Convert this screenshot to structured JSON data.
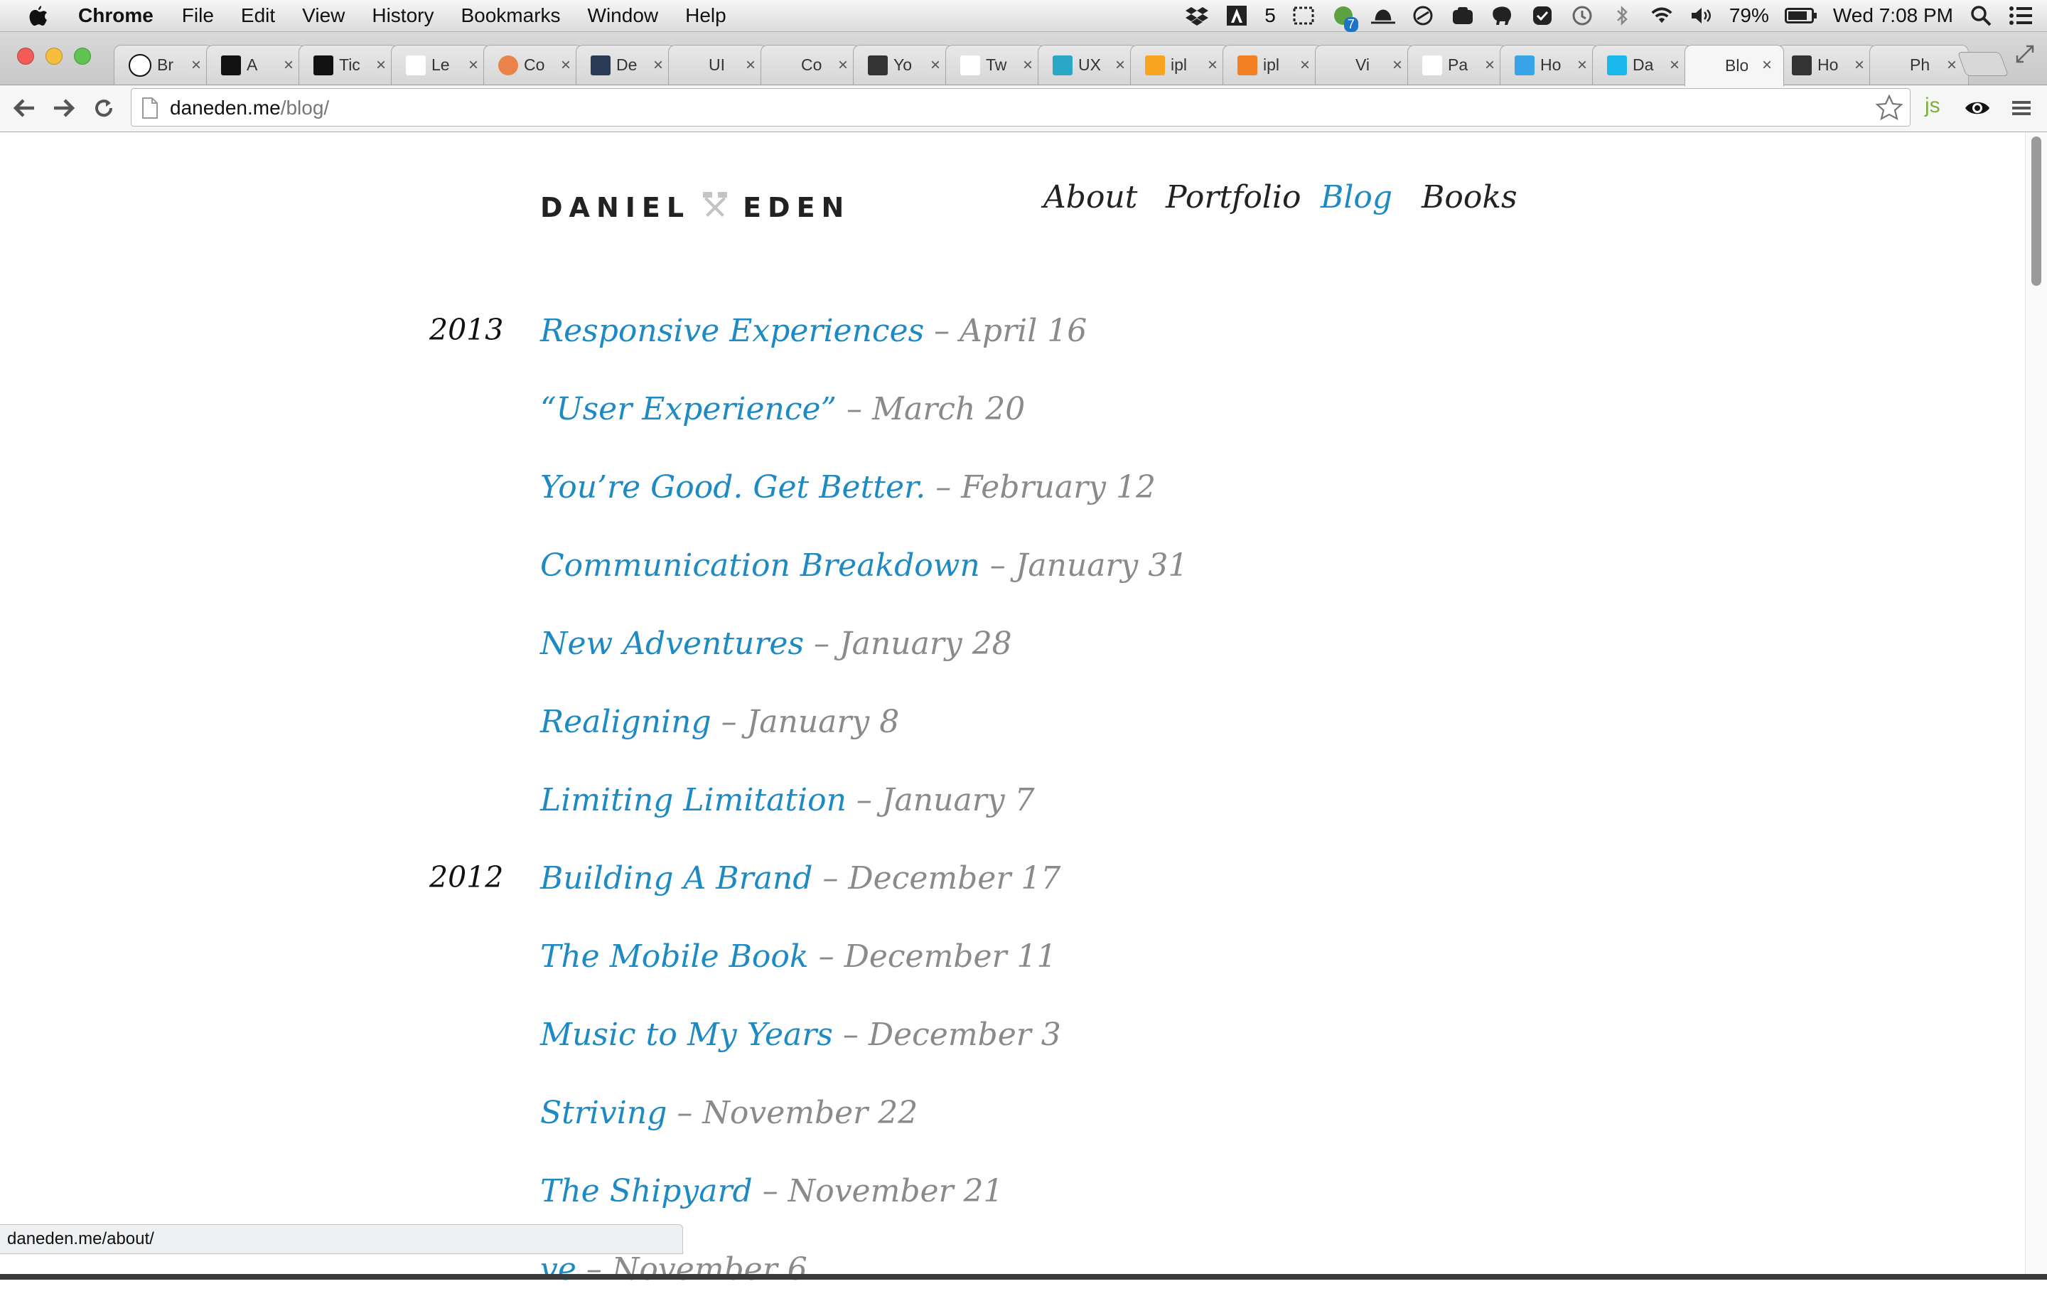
{
  "menubar": {
    "app_name": "Chrome",
    "items": [
      "File",
      "Edit",
      "View",
      "History",
      "Bookmarks",
      "Window",
      "Help"
    ],
    "adobe_count": "5",
    "evernote_badge": "7",
    "battery": "79%",
    "clock": "Wed 7:08 PM"
  },
  "tabs": [
    {
      "title": "Br",
      "favicon": "github-icon"
    },
    {
      "title": "A",
      "favicon": "medium-icon"
    },
    {
      "title": "Tic",
      "favicon": "tictail-icon"
    },
    {
      "title": "Le",
      "favicon": "lettering-icon"
    },
    {
      "title": "Co",
      "favicon": "codepen-icon"
    },
    {
      "title": "De",
      "favicon": "dribbble-icon"
    },
    {
      "title": "UI",
      "favicon": "apple-icon"
    },
    {
      "title": "Co",
      "favicon": "apple-icon"
    },
    {
      "title": "Yo",
      "favicon": "a-icon"
    },
    {
      "title": "Tw",
      "favicon": "typekit-icon"
    },
    {
      "title": "UX",
      "favicon": "ux-icon"
    },
    {
      "title": "ipl",
      "favicon": "iplayer-icon"
    },
    {
      "title": "ipl",
      "favicon": "stack-icon"
    },
    {
      "title": "Vi",
      "favicon": "apple-icon"
    },
    {
      "title": "Pa",
      "favicon": "dt-icon"
    },
    {
      "title": "Ho",
      "favicon": "quote-icon"
    },
    {
      "title": "Da",
      "favicon": "vimeo-icon"
    },
    {
      "title": "Blo",
      "favicon": "hammers-icon",
      "active": true
    },
    {
      "title": "Ho",
      "favicon": "bc-icon"
    },
    {
      "title": "Ph",
      "favicon": "ph-icon"
    }
  ],
  "toolbar": {
    "url_host": "daneden.me",
    "url_path": "/blog/",
    "extension_js": "js"
  },
  "site": {
    "logo_first": "DANIEL",
    "logo_last": "EDEN",
    "nav": {
      "about": "About",
      "portfolio": "Portfolio",
      "blog": "Blog",
      "books": "Books"
    }
  },
  "posts": [
    {
      "year": "2013",
      "title": "Responsive Experiences",
      "date": "– April 16"
    },
    {
      "title": "“User Experience”",
      "date": "– March 20"
    },
    {
      "title": "You’re Good. Get Better.",
      "date": "– February 12"
    },
    {
      "title": "Communication Breakdown",
      "date": "– January 31"
    },
    {
      "title": "New Adventures",
      "date": "– January 28"
    },
    {
      "title": "Realigning",
      "date": "– January 8"
    },
    {
      "title": "Limiting Limitation",
      "date": "– January 7"
    },
    {
      "year": "2012",
      "title": "Building A Brand",
      "date": "– December 17"
    },
    {
      "title": "The Mobile Book",
      "date": "– December 11"
    },
    {
      "title": "Music to My Years",
      "date": "– December 3"
    },
    {
      "title": "Striving",
      "date": "– November 22"
    },
    {
      "title": "The Shipyard",
      "date": "– November 21"
    },
    {
      "title": "ve",
      "date": "– November 6"
    }
  ],
  "status_bar": "daneden.me/about/",
  "colors": {
    "link": "#1e8ac4",
    "date": "#8a8a8a",
    "text": "#222222"
  }
}
